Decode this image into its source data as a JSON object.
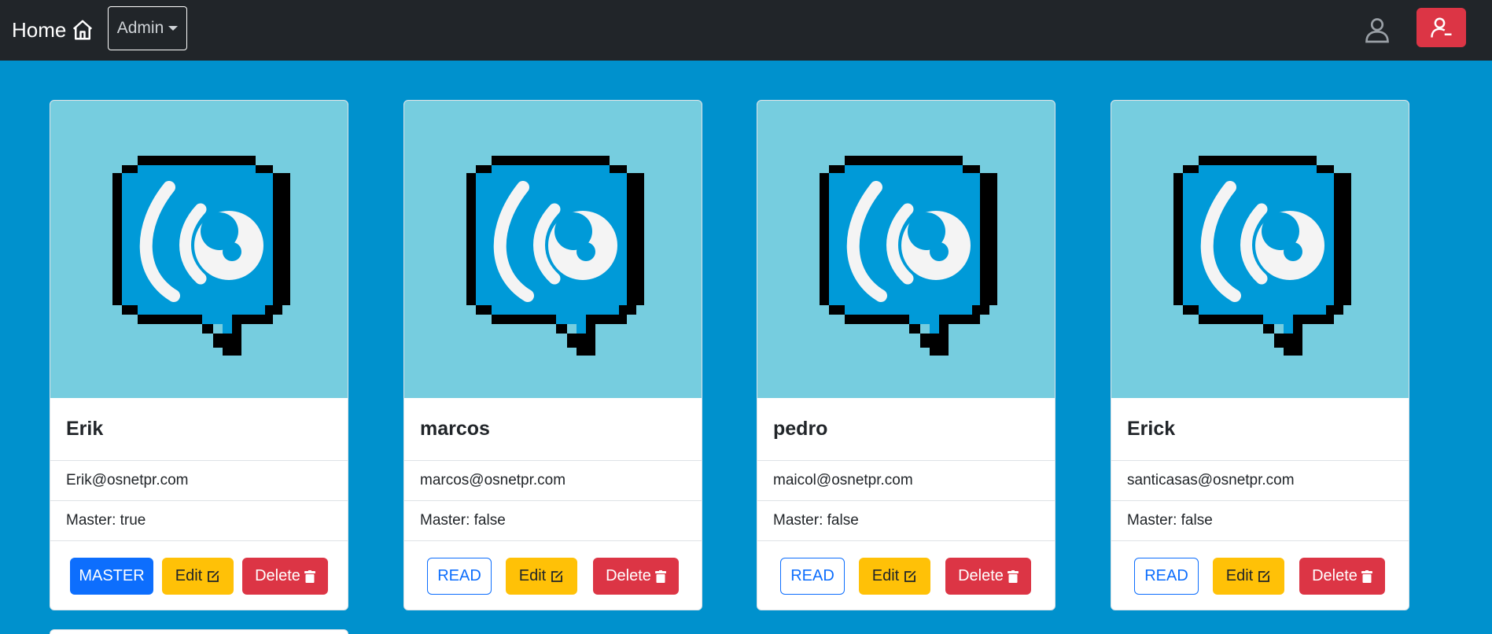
{
  "nav": {
    "home_label": "Home",
    "admin_label": "Admin",
    "icons": [
      "home-icon",
      "user-icon",
      "logout-icon"
    ],
    "colors": {
      "navbar": "#212529",
      "logout": "#dc3545"
    }
  },
  "users": [
    {
      "name": "Erik",
      "email": "Erik@osnetpr.com",
      "master": "Master: true",
      "role_label": "MASTER",
      "edit_label": "Edit",
      "delete_label": "Delete"
    },
    {
      "name": "marcos",
      "email": "marcos@osnetpr.com",
      "master": "Master: false",
      "role_label": "READ",
      "edit_label": "Edit",
      "delete_label": "Delete"
    },
    {
      "name": "pedro",
      "email": "maicol@osnetpr.com",
      "master": "Master: false",
      "role_label": "READ",
      "edit_label": "Edit",
      "delete_label": "Delete"
    },
    {
      "name": "Erick",
      "email": "santicasas@osnetpr.com",
      "master": "Master: false",
      "role_label": "READ",
      "edit_label": "Edit",
      "delete_label": "Delete"
    }
  ],
  "colors": {
    "page_bg": "#0091cd",
    "card_image_bg": "#76cddf",
    "master": "#0d6efd",
    "edit": "#ffc107",
    "delete": "#dc3545"
  }
}
